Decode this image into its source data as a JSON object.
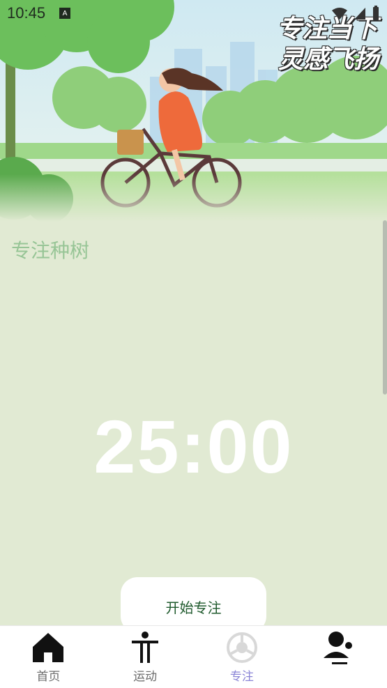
{
  "status": {
    "time": "10:45",
    "notif_icon": "a-icon"
  },
  "hero": {
    "line1": "专注当下",
    "line2": "灵感飞扬"
  },
  "section": {
    "title": "专注种树"
  },
  "timer": {
    "value": "25:00"
  },
  "start": {
    "label": "开始专注"
  },
  "nav": {
    "items": [
      {
        "label": "首页",
        "icon": "home-icon"
      },
      {
        "label": "运动",
        "icon": "exercise-icon"
      },
      {
        "label": "专注",
        "icon": "focus-icon",
        "active": true
      },
      {
        "label": "",
        "icon": "profile-icon"
      }
    ]
  },
  "colors": {
    "background": "#e1ead3",
    "accent": "#8a84d6",
    "title": "#97c596",
    "button_text": "#1f5a2d"
  }
}
